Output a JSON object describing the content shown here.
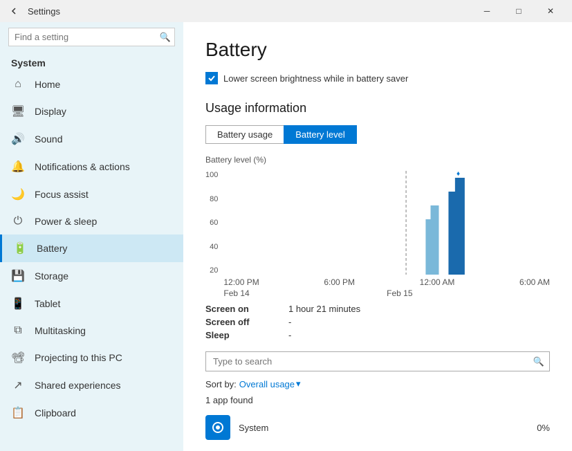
{
  "titlebar": {
    "back_icon": "←",
    "title": "Settings",
    "minimize_icon": "─",
    "maximize_icon": "□",
    "close_icon": "✕"
  },
  "sidebar": {
    "search_placeholder": "Find a setting",
    "section_label": "System",
    "items": [
      {
        "id": "home",
        "label": "Home",
        "icon": "⌂"
      },
      {
        "id": "display",
        "label": "Display",
        "icon": "🖥"
      },
      {
        "id": "sound",
        "label": "Sound",
        "icon": "🔊"
      },
      {
        "id": "notifications",
        "label": "Notifications & actions",
        "icon": "🔔"
      },
      {
        "id": "focus",
        "label": "Focus assist",
        "icon": "🌙"
      },
      {
        "id": "power",
        "label": "Power & sleep",
        "icon": "⏻"
      },
      {
        "id": "battery",
        "label": "Battery",
        "icon": "🔋",
        "active": true
      },
      {
        "id": "storage",
        "label": "Storage",
        "icon": "💾"
      },
      {
        "id": "tablet",
        "label": "Tablet",
        "icon": "📱"
      },
      {
        "id": "multitasking",
        "label": "Multitasking",
        "icon": "⧉"
      },
      {
        "id": "projecting",
        "label": "Projecting to this PC",
        "icon": "📽"
      },
      {
        "id": "shared",
        "label": "Shared experiences",
        "icon": "↗"
      },
      {
        "id": "clipboard",
        "label": "Clipboard",
        "icon": "📋"
      }
    ]
  },
  "content": {
    "page_title": "Battery",
    "checkbox_label": "Lower screen brightness while in battery saver",
    "section_title": "Usage information",
    "tab_battery_usage": "Battery usage",
    "tab_battery_level": "Battery level",
    "chart_y_label": "Battery level (%)",
    "chart_y_ticks": [
      "100",
      "80",
      "60",
      "40",
      "20"
    ],
    "chart_x_ticks": [
      "12:00 PM",
      "6:00 PM",
      "12:00 AM",
      "6:00 AM"
    ],
    "chart_dates": [
      "Feb 14",
      "",
      "",
      "Feb 15"
    ],
    "screen_on_label": "Screen on",
    "screen_on_value": "1 hour 21 minutes",
    "screen_off_label": "Screen off",
    "screen_off_value": "-",
    "sleep_label": "Sleep",
    "sleep_value": "-",
    "search_placeholder": "Type to search",
    "sort_label": "Sort by:",
    "sort_value": "Overall usage",
    "sort_icon": "▾",
    "apps_count": "1 app found",
    "app_name": "System",
    "app_usage": "0%"
  }
}
